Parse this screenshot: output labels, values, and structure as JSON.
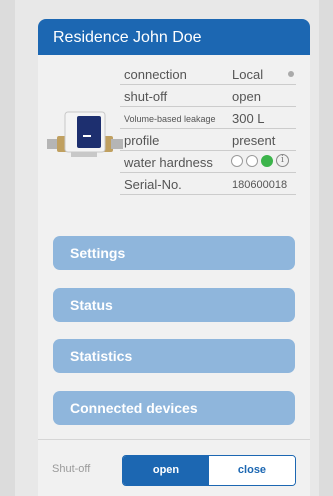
{
  "header": {
    "title": "Residence John Doe"
  },
  "details": {
    "connection": {
      "label": "connection",
      "value": "Local"
    },
    "shutoff": {
      "label": "shut-off",
      "value": "open"
    },
    "leakage": {
      "label": "Volume-based leakage",
      "value": "300 L"
    },
    "profile": {
      "label": "profile",
      "value": "present"
    },
    "hardness": {
      "label": "water hardness"
    },
    "serial": {
      "label": "Serial-No.",
      "value": "180600018"
    }
  },
  "nav": [
    "Settings",
    "Status",
    "Statistics",
    "Connected devices"
  ],
  "footer": {
    "label": "Shut-off",
    "open": "open",
    "close": "close"
  },
  "colors": {
    "header": "#1c67b2",
    "button": "#8fb6dc",
    "green": "#3cb44b"
  }
}
